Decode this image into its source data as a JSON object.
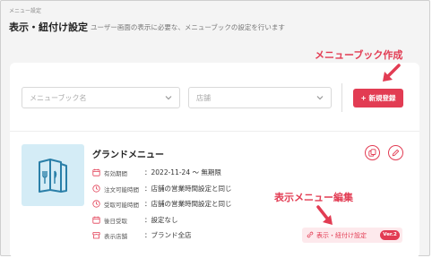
{
  "header": {
    "breadcrumb": "メニュー設定",
    "title": "表示・紐付け設定",
    "subtitle": "ユーザー画面の表示に必要な、メニューブックの設定を行います"
  },
  "filters": {
    "menubook_placeholder": "メニューブック名",
    "store_placeholder": "店舗",
    "new_button": "+ 新規登録"
  },
  "menu": {
    "name": "グランドメニュー",
    "rows": [
      {
        "label": "有効期間",
        "value": "：2022-11-24 〜 無期限",
        "icon": "calendar-icon"
      },
      {
        "label": "注文可能時間",
        "value": "：店舗の営業時間設定と同じ",
        "icon": "clock-icon"
      },
      {
        "label": "受取可能時間",
        "value": "：店舗の営業時間設定と同じ",
        "icon": "clock-icon"
      },
      {
        "label": "後日受取",
        "value": "：設定なし",
        "icon": "calendar-icon"
      },
      {
        "label": "表示店舗",
        "value": "：ブランド全店",
        "icon": "store-icon"
      }
    ],
    "edit_chip_label": "表示・紐付け設定",
    "version_badge": "Ver.2"
  },
  "annotations": {
    "create": "メニューブック作成",
    "edit": "表示メニュー編集"
  },
  "colors": {
    "accent": "#e23c53",
    "thumb_bg": "#d4ecf6",
    "thumb_icon": "#2a7fa8"
  }
}
